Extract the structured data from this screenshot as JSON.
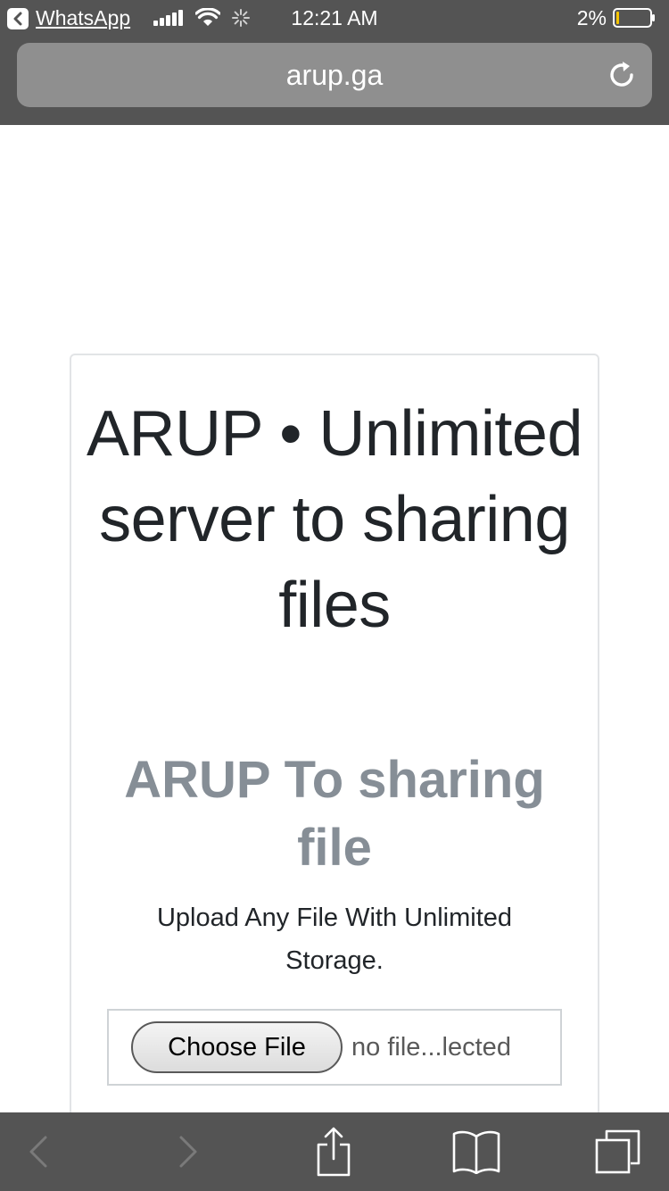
{
  "status_bar": {
    "back_app_label": "WhatsApp",
    "time": "12:21 AM",
    "battery_percent": "2%",
    "battery_level": 0.02,
    "icons": [
      "back-arrow-icon",
      "cellular-signal-icon",
      "wifi-icon",
      "activity-spinner-icon",
      "battery-icon"
    ]
  },
  "address_bar": {
    "url": "arup.ga",
    "reload_icon": "reload-icon"
  },
  "page": {
    "title": "ARUP • Unlimited server to sharing files",
    "subtitle": "ARUP To sharing file",
    "lead": "Upload Any File With Unlimited Storage.",
    "file_input": {
      "button_label": "Choose File",
      "status": "no file...lected"
    }
  },
  "toolbar": {
    "items": [
      "back-icon",
      "forward-icon",
      "share-icon",
      "bookmarks-icon",
      "tabs-icon"
    ]
  },
  "colors": {
    "chrome": "#545454",
    "url_field": "#8f8f8f",
    "title": "#212529",
    "subtitle": "#868e96",
    "battery_low": "#f5c400"
  }
}
